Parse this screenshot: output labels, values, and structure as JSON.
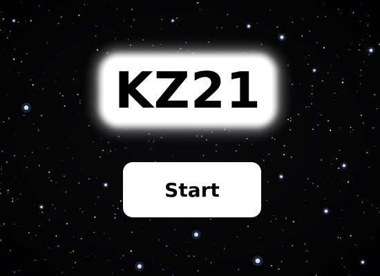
{
  "game": {
    "title": "KZ21",
    "start_label": "Start"
  },
  "colors": {
    "background": "#050505",
    "panel": "#ffffff",
    "text": "#000000",
    "star_blue": "#8fb6ff",
    "star_warm": "#ffd9a8"
  }
}
